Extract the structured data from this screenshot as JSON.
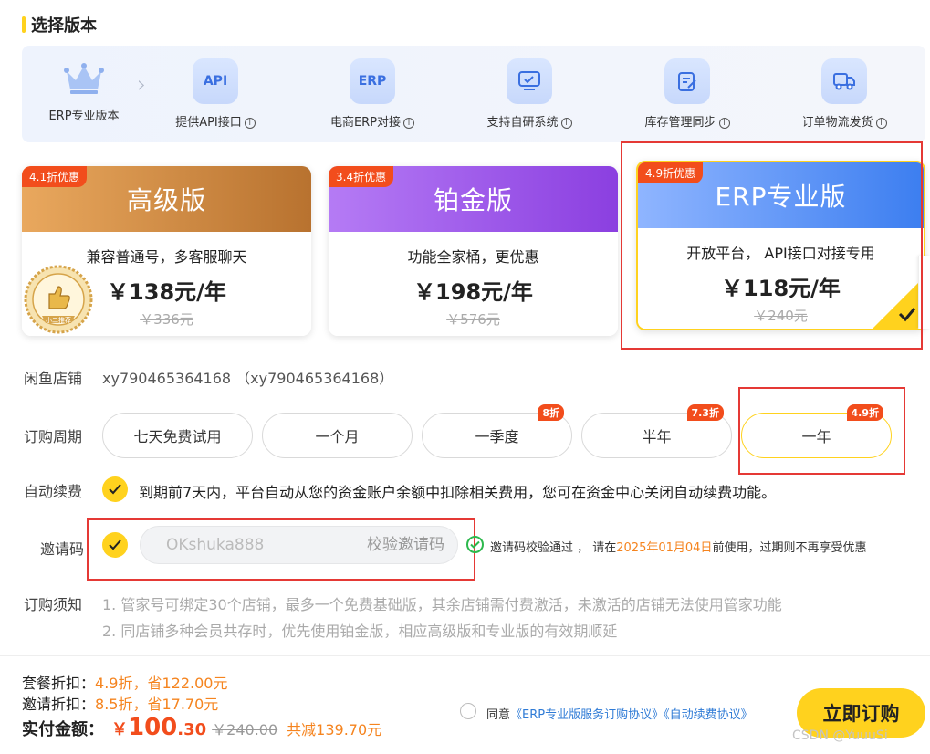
{
  "section_title": "选择版本",
  "features": {
    "crown_label": "ERP专业版本",
    "items": [
      {
        "icon_text": "API",
        "label": "提供API接口"
      },
      {
        "icon_text": "ERP",
        "label": "电商ERP对接"
      },
      {
        "icon": "monitor-check-icon",
        "label": "支持自研系统"
      },
      {
        "icon": "clipboard-edit-icon",
        "label": "库存管理同步"
      },
      {
        "icon": "delivery-truck-icon",
        "label": "订单物流发货"
      }
    ],
    "info_glyph": "i"
  },
  "plans": [
    {
      "badge": "4.1折优惠",
      "name": "高级版",
      "desc": "兼容普通号，多客服聊天",
      "price": "￥138元/年",
      "original": "￥336元",
      "seal": "小二推荐",
      "head_color": "#c8843b"
    },
    {
      "badge": "3.4折优惠",
      "name": "铂金版",
      "desc": "功能全家桶，更优惠",
      "price": "￥198元/年",
      "original": "￥576元",
      "head_color": "#9b4fe6"
    },
    {
      "badge": "4.9折优惠",
      "name": "ERP专业版",
      "desc": "开放平台， API接口对接专用",
      "price": "￥118元/年",
      "original": "￥240元",
      "head_color": "#4a86f0",
      "selected": true
    }
  ],
  "shop": {
    "label": "闲鱼店铺",
    "value": "xy790465364168 （xy790465364168）"
  },
  "period": {
    "label": "订购周期",
    "options": [
      {
        "label": "七天免费试用",
        "tag": ""
      },
      {
        "label": "一个月",
        "tag": ""
      },
      {
        "label": "一季度",
        "tag": "8折"
      },
      {
        "label": "半年",
        "tag": "7.3折"
      },
      {
        "label": "一年",
        "tag": "4.9折",
        "active": true
      }
    ]
  },
  "auto_renew": {
    "label": "自动续费",
    "text": "到期前7天内，平台自动从您的资金账户余额中扣除相关费用，您可在资金中心关闭自动续费功能。"
  },
  "invite": {
    "label": "邀请码",
    "value": "OKshuka888",
    "verify_label": "校验邀请码",
    "msg_prefix": "邀请码校验通过 ， 请在",
    "msg_date": "2025年01月04日",
    "msg_suffix": "前使用，过期则不再享受优惠"
  },
  "notice": {
    "label": "订购须知",
    "lines": [
      "1. 管家号可绑定30个店铺，最多一个免费基础版，其余店铺需付费激活，未激活的店铺无法使用管家功能",
      "2. 同店铺多种会员共存时，优先使用铂金版，相应高级版和专业版的有效期顺延"
    ]
  },
  "summary": {
    "package_label": "套餐折扣：",
    "package_value": "4.9折，省122.00元",
    "invite_label": "邀请折扣：",
    "invite_value": "8.5折，省17.70元",
    "total_label": "实付金额：",
    "currency": "￥",
    "total_int": "100",
    "total_dec": ".30",
    "total_orig": "￥240.00",
    "total_saved": "共减139.70元"
  },
  "agreement": {
    "prefix": "同意",
    "link1": "《ERP专业版服务订购协议》",
    "link2": "《自动续费协议》"
  },
  "buy_button": "立即订购",
  "watermark": "CSDN @YuuuSi",
  "colors": {
    "accent": "#ffd21e",
    "discount_red": "#f24d1c",
    "highlight_orange": "#f5841f",
    "frame_red": "#e53935",
    "link_blue": "#2f7bd6",
    "success_green": "#2db84d"
  }
}
